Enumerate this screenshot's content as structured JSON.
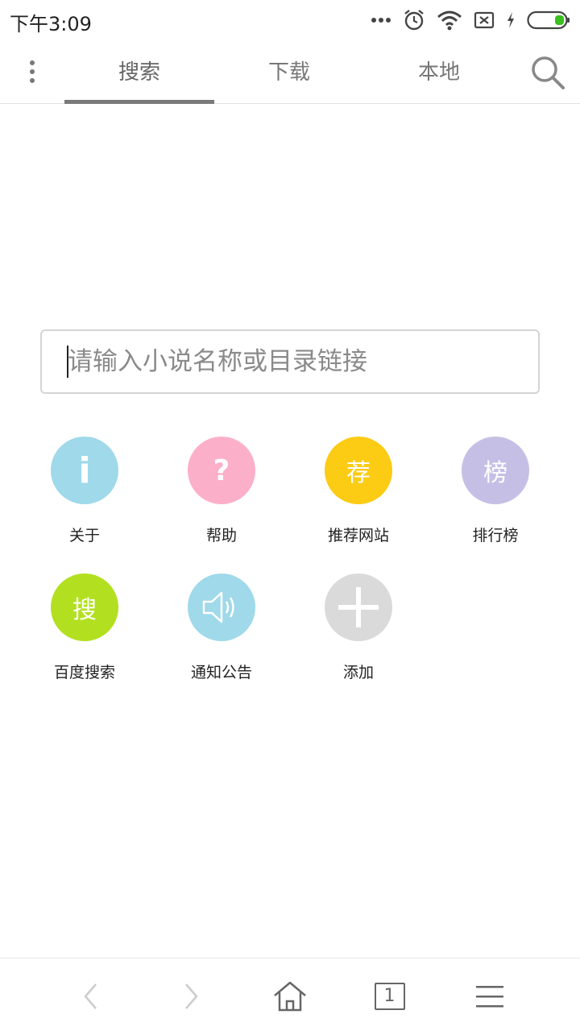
{
  "status_bar": {
    "time": "下午3:09",
    "icons": [
      "more-dots-icon",
      "alarm-icon",
      "wifi-icon",
      "sim-none-icon",
      "charging-icon",
      "battery-icon"
    ]
  },
  "tabs": [
    {
      "label": "搜索",
      "active": true
    },
    {
      "label": "下载",
      "active": false
    },
    {
      "label": "本地",
      "active": false
    }
  ],
  "search": {
    "placeholder": "请输入小说名称或目录链接",
    "value": ""
  },
  "shortcuts": [
    {
      "label": "关于",
      "glyph": "i",
      "icon": "info-icon",
      "color": "#9fd9ea"
    },
    {
      "label": "帮助",
      "glyph": "?",
      "icon": "help-icon",
      "color": "#fcafc8"
    },
    {
      "label": "推荐网站",
      "glyph": "荐",
      "icon": "recommend-icon",
      "color": "#fccb14"
    },
    {
      "label": "排行榜",
      "glyph": "榜",
      "icon": "ranking-icon",
      "color": "#c6bfe5"
    },
    {
      "label": "百度搜索",
      "glyph": "搜",
      "icon": "baidu-search-icon",
      "color": "#b2e020"
    },
    {
      "label": "通知公告",
      "glyph": "",
      "icon": "speaker-icon",
      "color": "#9fd9ea"
    },
    {
      "label": "添加",
      "glyph": "",
      "icon": "plus-icon",
      "color": "#dadada"
    }
  ],
  "bottom_nav": {
    "tab_count": "1",
    "icons": [
      "back-icon",
      "forward-icon",
      "home-icon",
      "tabs-icon",
      "menu-icon"
    ]
  },
  "colors": {
    "accent_indicator": "#7a7a7a",
    "disabled_arrow": "#cccccc",
    "nav_icon": "#666666"
  }
}
